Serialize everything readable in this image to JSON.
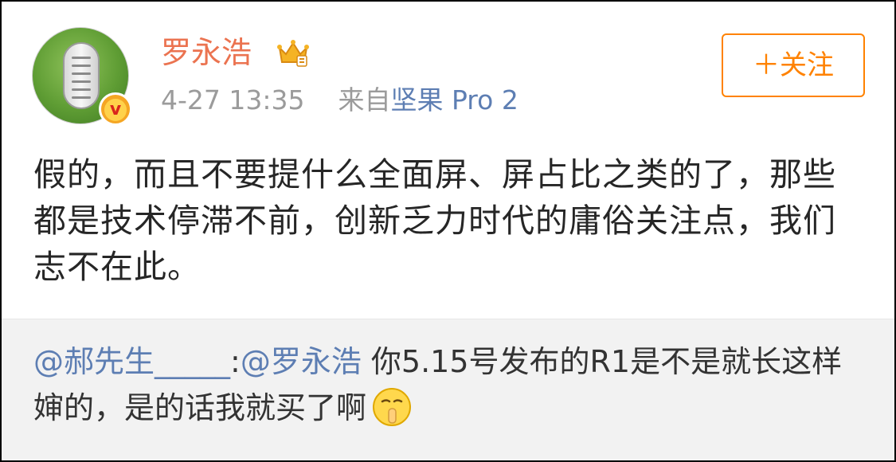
{
  "post": {
    "author": {
      "name": "罗永浩",
      "avatar_icon": "shoe-sole-on-grass-avatar",
      "badge_icon": "verified-v-badge",
      "vip_icon": "vip-crown-icon",
      "badge_glyph": "v"
    },
    "time": "4-27 13:35",
    "source_prefix": "来自",
    "source_device": "坚果 Pro 2",
    "follow_label": "＋关注",
    "content": "假的，而且不要提什么全面屏、屏占比之类的了，那些都是技术停滞不前，创新乏力时代的庸俗关注点，我们志不在此。"
  },
  "quoted": {
    "mention_user": "@郝先生_____",
    "separator": ":",
    "reply_to": "@罗永浩",
    "text": " 你5.15号发布的R1是不是就长这样婶的，是的话我就买了啊",
    "emoji_icon": "shush-face-emoji"
  },
  "colors": {
    "name": "#eb7350",
    "follow": "#ff8200",
    "link": "#5d7eb3",
    "meta": "#9b9b9b",
    "body": "#262626",
    "quote_bg": "#f2f2f2"
  }
}
